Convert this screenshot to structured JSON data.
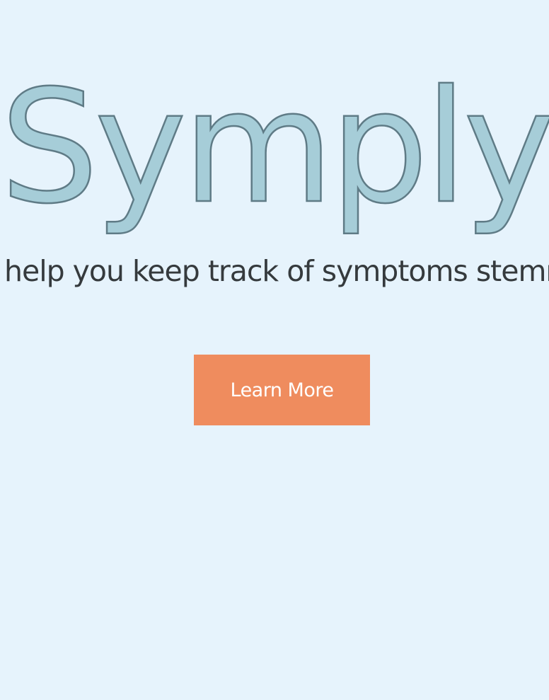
{
  "hero": {
    "title": "Symply",
    "tagline": "help you keep track of symptoms stemr",
    "cta_label": "Learn More"
  },
  "colors": {
    "background": "#e6f3fc",
    "title_fill": "#a6cdd8",
    "title_outline": "#5f7b86",
    "tagline_text": "#353a3d",
    "cta_background": "#ef8c5e",
    "cta_text": "#ffffff"
  }
}
